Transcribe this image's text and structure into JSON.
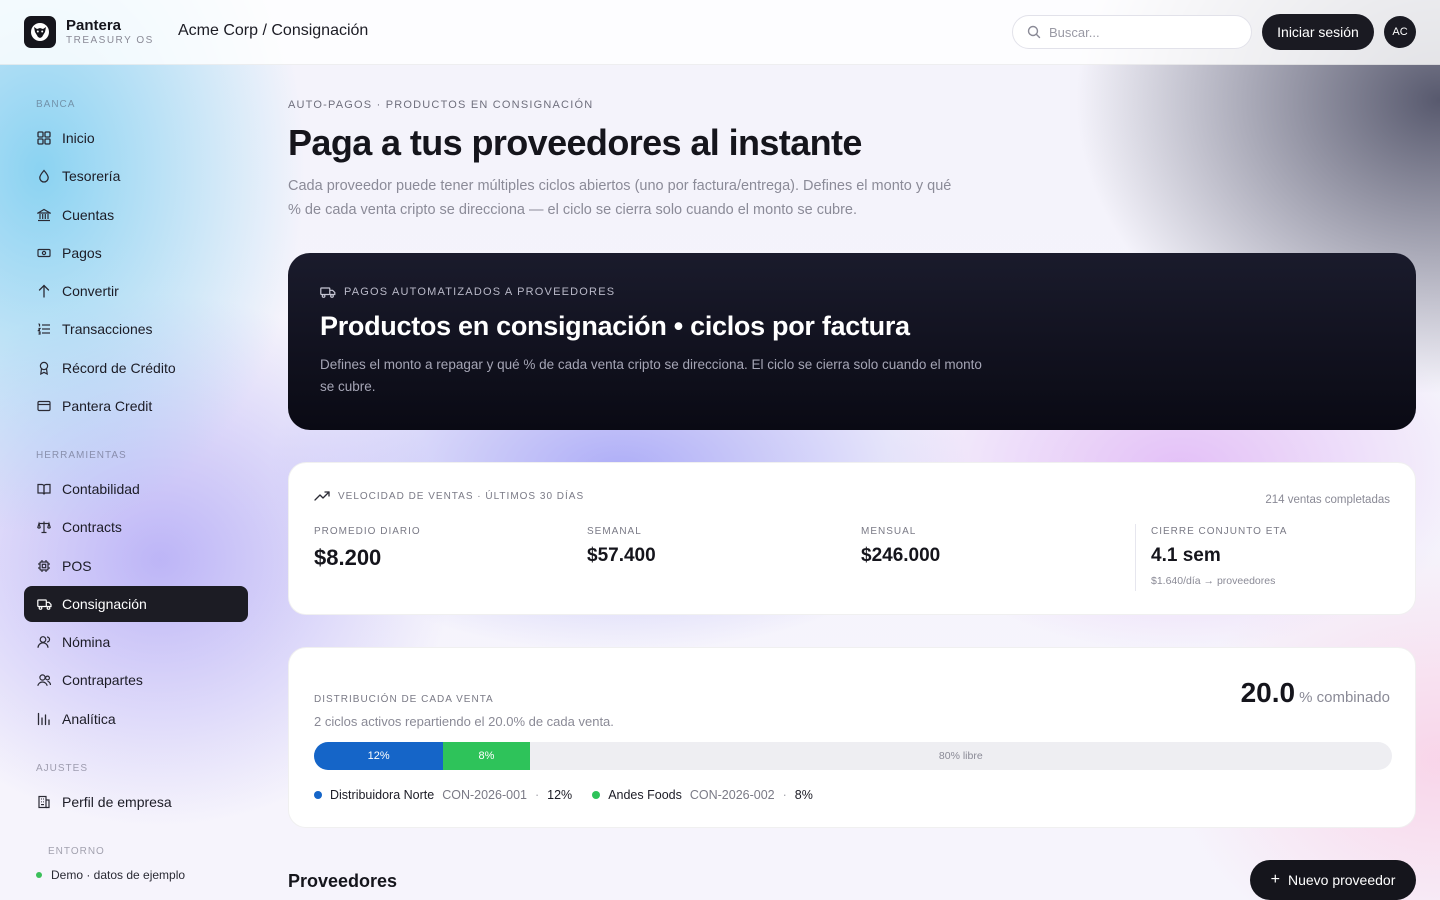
{
  "brand": {
    "name": "Pantera",
    "subtitle": "TREASURY OS"
  },
  "header": {
    "breadcrumb": "Acme Corp / Consignación",
    "search_placeholder": "Buscar...",
    "login_label": "Iniciar sesión",
    "avatar_initials": "AC"
  },
  "sidebar": {
    "sections": [
      {
        "label": "BANCA"
      },
      {
        "label": "HERRAMIENTAS"
      },
      {
        "label": "AJUSTES"
      }
    ],
    "items": [
      {
        "label": "Inicio",
        "icon": "grid-icon"
      },
      {
        "label": "Tesorería",
        "icon": "droplet-icon"
      },
      {
        "label": "Cuentas",
        "icon": "bank-icon"
      },
      {
        "label": "Pagos",
        "icon": "banknote-icon"
      },
      {
        "label": "Convertir",
        "icon": "arrow-up-icon"
      },
      {
        "label": "Transacciones",
        "icon": "list-ordered-icon"
      },
      {
        "label": "Récord de Crédito",
        "icon": "award-icon"
      },
      {
        "label": "Pantera Credit",
        "icon": "credit-card-icon"
      },
      {
        "label": "Contabilidad",
        "icon": "book-open-icon"
      },
      {
        "label": "Contracts",
        "icon": "scale-icon"
      },
      {
        "label": "POS",
        "icon": "cpu-icon"
      },
      {
        "label": "Consignación",
        "icon": "truck-icon",
        "active": true
      },
      {
        "label": "Nómina",
        "icon": "user-icon"
      },
      {
        "label": "Contrapartes",
        "icon": "users-icon"
      },
      {
        "label": "Analítica",
        "icon": "bar-chart-icon"
      },
      {
        "label": "Perfil de empresa",
        "icon": "building-icon"
      }
    ],
    "environment": {
      "label": "ENTORNO",
      "value": "Demo · datos de ejemplo"
    }
  },
  "page": {
    "eyebrow": "AUTO-PAGOS · PRODUCTOS EN CONSIGNACIÓN",
    "title": "Paga a tus proveedores al instante",
    "description": "Cada proveedor puede tener múltiples ciclos abiertos (uno por factura/entrega). Defines el monto y qué % de cada venta cripto se direcciona — el ciclo se cierra solo cuando el monto se cubre."
  },
  "hero": {
    "eyebrow": "PAGOS AUTOMATIZADOS A PROVEEDORES",
    "title": "Productos en consignación • ciclos por factura",
    "subtitle": "Defines el monto a repagar y qué % de cada venta cripto se direcciona. El ciclo se cierra solo cuando el monto se cubre."
  },
  "velocity": {
    "eyebrow": "VELOCIDAD DE VENTAS · ÚLTIMOS 30 DÍAS",
    "count": "214 ventas completadas",
    "stats": [
      {
        "label": "PROMEDIO DIARIO",
        "value": "$8.200"
      },
      {
        "label": "SEMANAL",
        "value": "$57.400"
      },
      {
        "label": "MENSUAL",
        "value": "$246.000"
      },
      {
        "label": "CIERRE CONJUNTO ETA",
        "value": "4.1 sem",
        "note": "$1.640/día → proveedores"
      }
    ]
  },
  "distribution": {
    "label": "DISTRIBUCIÓN DE CADA VENTA",
    "summary": "2 ciclos activos repartiendo el 20.0% de cada venta.",
    "total_value": "20.0",
    "total_unit": "% combinado",
    "segments": [
      {
        "label": "12%",
        "percent": 12,
        "color": "#1565c8"
      },
      {
        "label": "8%",
        "percent": 8,
        "color": "#2ec35a"
      }
    ],
    "free_label": "80% libre",
    "legend": [
      {
        "name": "Distribuidora Norte",
        "code": "CON-2026-001",
        "pct": "12%",
        "color": "#1565c8"
      },
      {
        "name": "Andes Foods",
        "code": "CON-2026-002",
        "pct": "8%",
        "color": "#2ec35a"
      }
    ]
  },
  "providers": {
    "title": "Proveedores",
    "new_label": "Nuevo proveedor"
  }
}
